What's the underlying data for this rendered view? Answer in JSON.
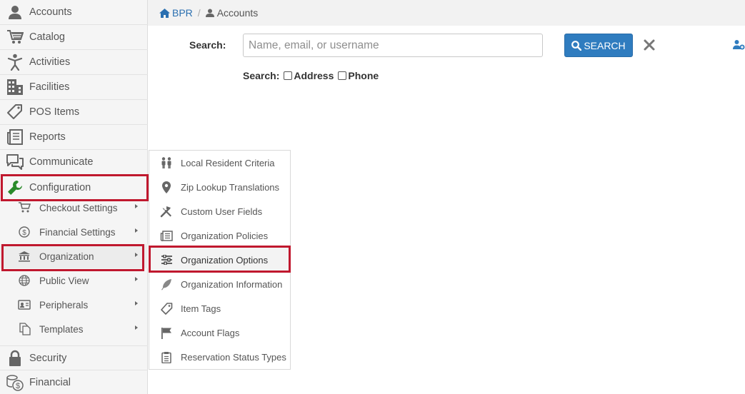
{
  "breadcrumb": {
    "home": "BPR",
    "separator": "/",
    "current": "Accounts"
  },
  "sidebar": {
    "items": [
      {
        "label": "Accounts",
        "icon": "user-icon"
      },
      {
        "label": "Catalog",
        "icon": "cart-icon"
      },
      {
        "label": "Activities",
        "icon": "person-icon"
      },
      {
        "label": "Facilities",
        "icon": "building-icon"
      },
      {
        "label": "POS Items",
        "icon": "tag-icon"
      },
      {
        "label": "Reports",
        "icon": "reports-icon"
      },
      {
        "label": "Communicate",
        "icon": "chat-icon"
      },
      {
        "label": "Configuration",
        "icon": "wrench-icon"
      },
      {
        "label": "Security",
        "icon": "lock-icon"
      },
      {
        "label": "Financial",
        "icon": "coins-icon"
      }
    ],
    "config_submenu": [
      {
        "label": "Checkout Settings",
        "icon": "cart-icon"
      },
      {
        "label": "Financial Settings",
        "icon": "dollar-circle-icon"
      },
      {
        "label": "Organization",
        "icon": "bank-icon"
      },
      {
        "label": "Public View",
        "icon": "globe-icon"
      },
      {
        "label": "Peripherals",
        "icon": "id-card-icon"
      },
      {
        "label": "Templates",
        "icon": "copy-icon"
      }
    ]
  },
  "flyout": {
    "items": [
      {
        "label": "Local Resident Criteria",
        "icon": "people-icon"
      },
      {
        "label": "Zip Lookup Translations",
        "icon": "map-pin-icon"
      },
      {
        "label": "Custom User Fields",
        "icon": "tools-icon"
      },
      {
        "label": "Organization Policies",
        "icon": "policies-icon"
      },
      {
        "label": "Organization Options",
        "icon": "sliders-icon"
      },
      {
        "label": "Organization Information",
        "icon": "feather-icon"
      },
      {
        "label": "Item Tags",
        "icon": "tag-icon"
      },
      {
        "label": "Account Flags",
        "icon": "flag-icon"
      },
      {
        "label": "Reservation Status Types",
        "icon": "clipboard-icon"
      }
    ]
  },
  "search": {
    "label": "Search:",
    "placeholder": "Name, email, or username",
    "value": "",
    "button": "SEARCH",
    "options_label": "Search:",
    "options": [
      "Address",
      "Phone"
    ]
  },
  "colors": {
    "accent": "#2f7cbf",
    "highlight_border": "#c0182e",
    "configuration_icon": "#2a8a2a"
  }
}
